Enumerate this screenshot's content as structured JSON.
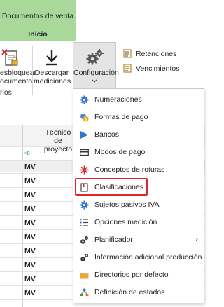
{
  "ribbon": {
    "tab_title": "Documentos de venta",
    "tab_name": "Inicio",
    "desbloquear_label_1": "esbloquear",
    "desbloquear_label_2": "ocumento",
    "group_label": "rios",
    "descargar_label_1": "Descargar",
    "descargar_label_2": "mediciones",
    "configuracion_label": "Configuración",
    "retenciones_label": "Retenciones",
    "vencimientos_label": "Vencimientos"
  },
  "grid": {
    "col_header_1": "Técnico de",
    "col_header_2": "proyecto",
    "filter_icon": "filter-cell-icon",
    "rows": [
      "MV",
      "MV",
      "MV",
      "MV",
      "MV",
      "MV",
      "MV",
      "MV",
      "MV",
      "MV"
    ]
  },
  "menu": {
    "items": [
      {
        "label": "Numeraciones",
        "icon": "gear-icon"
      },
      {
        "label": "Formas de pago",
        "icon": "coins-icon"
      },
      {
        "label": "Bancos",
        "icon": "bank-icon"
      },
      {
        "label": "Modos de pago",
        "icon": "card-icon"
      },
      {
        "label": "Conceptos de roturas",
        "icon": "burst-icon"
      },
      {
        "label": "Clasificaciones",
        "icon": "book-icon"
      },
      {
        "label": "Sujetos pasivos IVA",
        "icon": "tax-gear-icon"
      },
      {
        "label": "Opciones medición",
        "icon": "list-gear-icon"
      },
      {
        "label": "Planificador",
        "icon": "gears-icon"
      },
      {
        "label": "Información adicional producción",
        "icon": "gears-icon"
      },
      {
        "label": "Directorios por defecto",
        "icon": "folder-icon"
      },
      {
        "label": "Definición de estados",
        "icon": "status-icon"
      }
    ]
  },
  "colors": {
    "tab_green": "#a9d99a",
    "highlight_red": "#e0262b",
    "icon_blue": "#2f76c7"
  }
}
